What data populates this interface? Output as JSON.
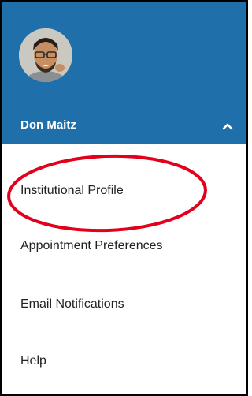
{
  "colors": {
    "header_background": "#1f70aa",
    "header_text": "#ffffff",
    "menu_text": "#222222",
    "annotation": "#e3001b"
  },
  "user": {
    "name": "Don Maitz",
    "avatar_icon": "user-photo"
  },
  "toggle": {
    "icon": "chevron-up-icon"
  },
  "menu": {
    "items": [
      {
        "label": "Institutional Profile"
      },
      {
        "label": "Appointment Preferences"
      },
      {
        "label": "Email Notifications"
      },
      {
        "label": "Help"
      }
    ]
  },
  "annotation": {
    "shape": "ellipse",
    "highlighted_item": "Institutional Profile"
  }
}
